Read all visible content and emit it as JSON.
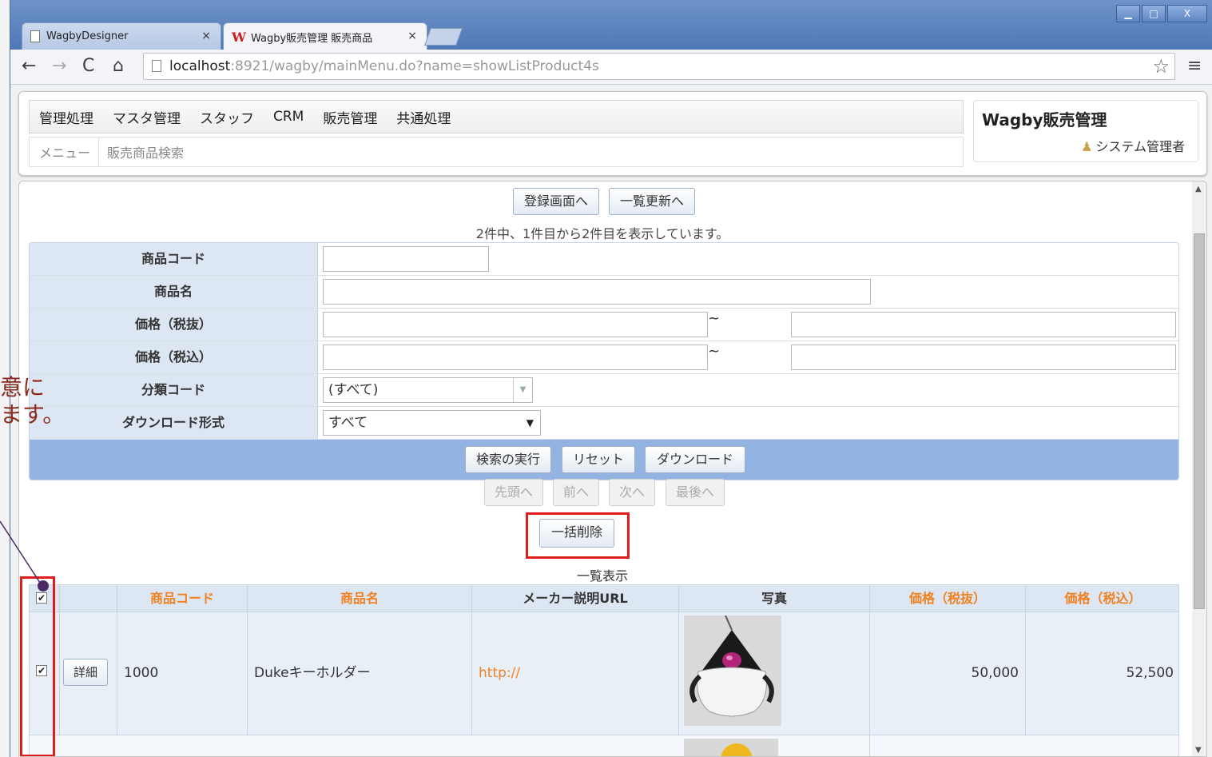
{
  "browser": {
    "tabs": [
      {
        "label": "WagbyDesigner",
        "close": "×"
      },
      {
        "label": "Wagby販売管理 販売商品",
        "close": "×"
      }
    ],
    "window_controls": [
      "▁",
      "□",
      "X"
    ],
    "url_host": "localhost",
    "url_rest": ":8921/wagby/mainMenu.do?name=showListProduct4s"
  },
  "app": {
    "menu": [
      "管理処理",
      "マスタ管理",
      "スタッフ",
      "CRM",
      "販売管理",
      "共通処理"
    ],
    "breadcrumb": [
      "メニュー",
      "販売商品検索"
    ],
    "title": "Wagby販売管理",
    "user": "システム管理者"
  },
  "actions": {
    "register": "登録画面へ",
    "bulk_update": "一覧更新へ"
  },
  "result_info": "2件中、1件目から2件目を表示しています。",
  "search_form": {
    "fields": [
      {
        "label": "商品コード",
        "value": ""
      },
      {
        "label": "商品名",
        "value": ""
      },
      {
        "label": "価格（税抜）",
        "from": "",
        "to": "",
        "separator": "~"
      },
      {
        "label": "価格（税込）",
        "from": "",
        "to": "",
        "separator": "~"
      },
      {
        "label": "分類コード",
        "value": "(すべて)"
      },
      {
        "label": "ダウンロード形式",
        "value": "すべて"
      }
    ],
    "buttons": {
      "search": "検索の実行",
      "reset": "リセット",
      "download": "ダウンロード"
    }
  },
  "pager": {
    "first": "先頭へ",
    "prev": "前へ",
    "next": "次へ",
    "last": "最後へ"
  },
  "bulk_delete": "一括削除",
  "list": {
    "title": "一覧表示",
    "columns": [
      "商品コード",
      "商品名",
      "メーカー説明URL",
      "写真",
      "価格（税抜）",
      "価格（税込）"
    ],
    "rows": [
      {
        "detail": "詳細",
        "code": "1000",
        "name": "Dukeキーホルダー",
        "url": "http://",
        "price_ex": "50,000",
        "price_in": "52,500",
        "checked": true
      }
    ]
  },
  "annotation": {
    "text": "意に\nます。"
  },
  "colors": {
    "highlight": "#e01c1c",
    "header_orange": "#f08020",
    "search_bar": "#93b4e2"
  }
}
